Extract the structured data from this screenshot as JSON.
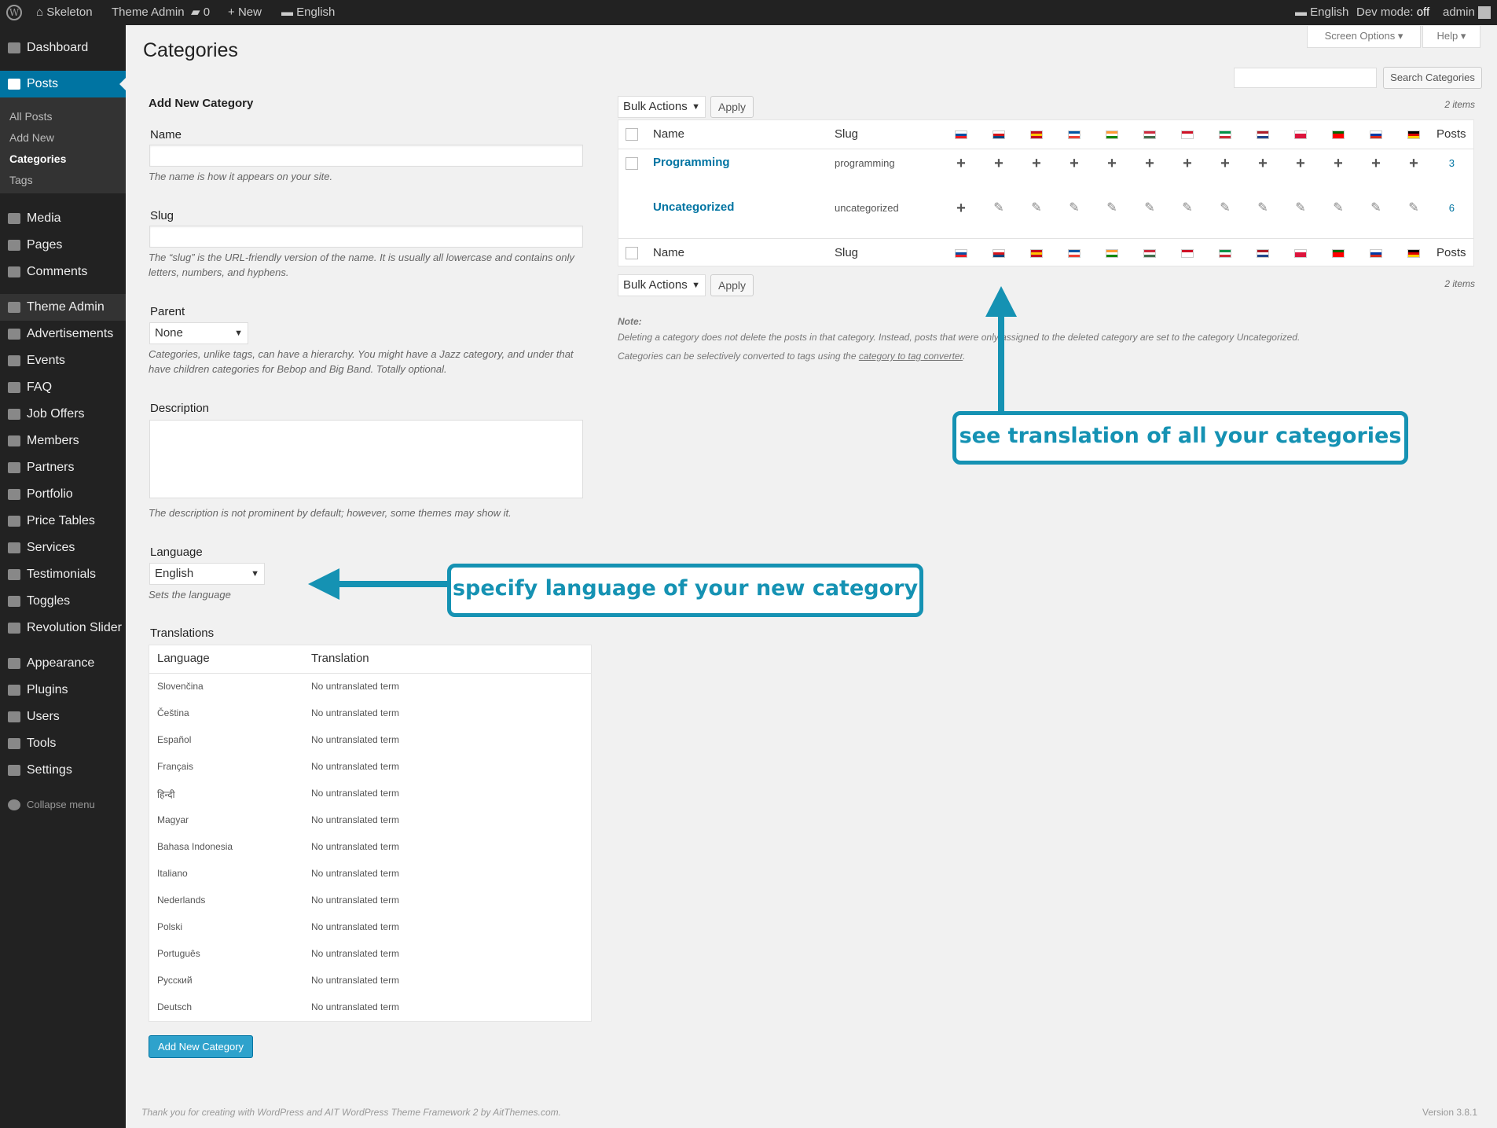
{
  "adminbar": {
    "site": "Skeleton",
    "theme_admin": "Theme Admin",
    "comments": "0",
    "new": "New",
    "lang_left": "English",
    "lang_right": "English",
    "devmode_label": "Dev mode:",
    "devmode_value": "off",
    "user": "admin"
  },
  "sidebar": {
    "items": [
      {
        "label": "Dashboard"
      },
      {
        "label": "Posts"
      },
      {
        "label": "Media"
      },
      {
        "label": "Pages"
      },
      {
        "label": "Comments"
      },
      {
        "label": "Theme Admin"
      },
      {
        "label": "Advertisements"
      },
      {
        "label": "Events"
      },
      {
        "label": "FAQ"
      },
      {
        "label": "Job Offers"
      },
      {
        "label": "Members"
      },
      {
        "label": "Partners"
      },
      {
        "label": "Portfolio"
      },
      {
        "label": "Price Tables"
      },
      {
        "label": "Services"
      },
      {
        "label": "Testimonials"
      },
      {
        "label": "Toggles"
      },
      {
        "label": "Revolution Slider"
      },
      {
        "label": "Appearance"
      },
      {
        "label": "Plugins"
      },
      {
        "label": "Users"
      },
      {
        "label": "Tools"
      },
      {
        "label": "Settings"
      },
      {
        "label": "Collapse menu"
      }
    ],
    "submenu": [
      "All Posts",
      "Add New",
      "Categories",
      "Tags"
    ]
  },
  "page_title": "Categories",
  "screen_options": "Screen Options",
  "help": "Help",
  "search_button": "Search Categories",
  "form": {
    "heading": "Add New Category",
    "name_label": "Name",
    "name_desc": "The name is how it appears on your site.",
    "slug_label": "Slug",
    "slug_desc": "The “slug” is the URL-friendly version of the name. It is usually all lowercase and contains only letters, numbers, and hyphens.",
    "parent_label": "Parent",
    "parent_value": "None",
    "parent_desc": "Categories, unlike tags, can have a hierarchy. You might have a Jazz category, and under that have children categories for Bebop and Big Band. Totally optional.",
    "description_label": "Description",
    "description_desc": "The description is not prominent by default; however, some themes may show it.",
    "language_label": "Language",
    "language_value": "English",
    "language_desc": "Sets the language",
    "translations_label": "Translations",
    "tr_col_language": "Language",
    "tr_col_translation": "Translation",
    "translations": [
      {
        "lang": "Slovenčina",
        "value": "No untranslated term"
      },
      {
        "lang": "Čeština",
        "value": "No untranslated term"
      },
      {
        "lang": "Español",
        "value": "No untranslated term"
      },
      {
        "lang": "Français",
        "value": "No untranslated term"
      },
      {
        "lang": "हिन्दी",
        "value": "No untranslated term"
      },
      {
        "lang": "Magyar",
        "value": "No untranslated term"
      },
      {
        "lang": "Bahasa Indonesia",
        "value": "No untranslated term"
      },
      {
        "lang": "Italiano",
        "value": "No untranslated term"
      },
      {
        "lang": "Nederlands",
        "value": "No untranslated term"
      },
      {
        "lang": "Polski",
        "value": "No untranslated term"
      },
      {
        "lang": "Português",
        "value": "No untranslated term"
      },
      {
        "lang": "Русский",
        "value": "No untranslated term"
      },
      {
        "lang": "Deutsch",
        "value": "No untranslated term"
      }
    ],
    "submit": "Add New Category"
  },
  "table": {
    "bulk_actions": "Bulk Actions",
    "apply": "Apply",
    "item_count": "2 items",
    "col_name": "Name",
    "col_slug": "Slug",
    "col_posts": "Posts",
    "flags": [
      {
        "name": "sk-flag",
        "colors": [
          "#ffffff",
          "#0b4ea2",
          "#ee1c25"
        ]
      },
      {
        "name": "cz-flag",
        "colors": [
          "#ffffff",
          "#d7141a",
          "#11457e"
        ]
      },
      {
        "name": "es-flag",
        "colors": [
          "#c60b1e",
          "#ffc400",
          "#c60b1e"
        ]
      },
      {
        "name": "fr-flag",
        "colors": [
          "#0055a4",
          "#ffffff",
          "#ef4135"
        ]
      },
      {
        "name": "in-flag",
        "colors": [
          "#ff9933",
          "#ffffff",
          "#138808"
        ]
      },
      {
        "name": "hu-flag",
        "colors": [
          "#cd2a3e",
          "#ffffff",
          "#436f4d"
        ]
      },
      {
        "name": "id-flag",
        "colors": [
          "#ce1126",
          "#ffffff",
          "#ffffff"
        ]
      },
      {
        "name": "it-flag",
        "colors": [
          "#009246",
          "#ffffff",
          "#ce2b37"
        ]
      },
      {
        "name": "nl-flag",
        "colors": [
          "#ae1c28",
          "#ffffff",
          "#21468b"
        ]
      },
      {
        "name": "pl-flag",
        "colors": [
          "#ffffff",
          "#dc143c",
          "#dc143c"
        ]
      },
      {
        "name": "pt-flag",
        "colors": [
          "#006600",
          "#ff0000",
          "#ff0000"
        ]
      },
      {
        "name": "ru-flag",
        "colors": [
          "#ffffff",
          "#0039a6",
          "#d52b1e"
        ]
      },
      {
        "name": "de-flag",
        "colors": [
          "#000000",
          "#dd0000",
          "#ffce00"
        ]
      }
    ],
    "rows": [
      {
        "name": "Programming",
        "slug": "programming",
        "count": "3"
      },
      {
        "name": "Uncategorized",
        "slug": "uncategorized",
        "count": "6"
      }
    ]
  },
  "note": {
    "title": "Note:",
    "line1": "Deleting a category does not delete the posts in that category. Instead, posts that were only assigned to the deleted category are set to the category Uncategorized.",
    "line2_pre": "Categories can be selectively converted to tags using the ",
    "line2_link": "category to tag converter",
    "line2_post": "."
  },
  "callouts": {
    "translations": "see translation of all your categories",
    "language": "specify language of your new category"
  },
  "footer": {
    "thanks": "Thank you for creating with WordPress and AIT WordPress Theme Framework 2 by AitThemes.com.",
    "version": "Version 3.8.1"
  },
  "colors": {
    "accent": "#0074a2",
    "callout": "#1592b3",
    "button_primary": "#2ea2cc"
  }
}
